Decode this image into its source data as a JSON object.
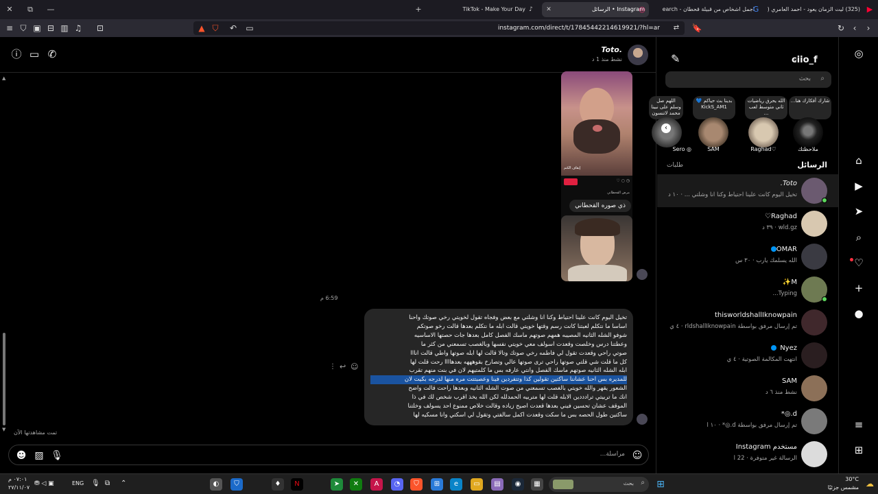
{
  "browser": {
    "tabs": [
      {
        "title": "(325) ليت الزمان يعود - احمد العامري (",
        "active": false
      },
      {
        "title": "اجمل اشخاص من قبيلة قحطان - earch",
        "active": false
      },
      {
        "title": "Instagram • الرسائل",
        "active": true
      },
      {
        "title": "TikTok - Make Your Day",
        "active": false
      }
    ],
    "url": "instagram.com/direct/t/17845442214619921/?hl=ar"
  },
  "chat": {
    "contact_name": "Toto.",
    "contact_status": "نشط منذ 1 د",
    "image_caption": "ذي صوره القحطاني",
    "timestamp": "6:59 م",
    "long_message_lines": [
      "تخيل اليوم كانت علينا احتياط وكنا انا وشلتي مع بعض وفجاه تقول لخويتي رخي صوتك واحنا",
      "اساسا ما نتكلم لعبتنا كانت رسم وقتها خويتي قالت ابله ما نتكلم بعدها قالت رخو صوتكم",
      "شوفو الشله الثانيه المصيبه همهم صوتهم ماسك الفصل كامل بعدها جات حصتها الاساسيه",
      "وعطتنا درس وخلصت وقعدت اسولف معي خويتي نفسها وبالغصب تسمعني من كثر ما",
      "صوتي راحي وقعدت تقول لي فاطمه رخي صوتك وتالا قالت لها ابله صوتها واطي قالت انااا",
      "كل ما قلت شي قلتي صوتها راحي ترى صوتها عالي وتصارخ بقوهههه بعدهاااا رحت قلت لها",
      "ابله الشله الثانيه صوتهم ماسك الفصل وانتي عارفه بس ما كلمتيهم لان في بنت منهم تقرب",
      "للمديره بس احنا عشاننا ساكتين تقولين كذا وتتفردين فينا وعصبتتت مره منها لدرجه بكيت لان",
      "الشعور يقهر والله خويتي بالغصب تسمعني من صوت الشله الثانيه وبعدها راحت قالت واضح",
      "انك ما تربيتي ترادددين الابله قلت لها متربيه الحمدلله لكن الله يخذ اقرب شخص لك في ذا",
      "الموقف عشان تحسين فيني بعدها قعدت اصيح زياده وقالت خلاص ممنوع احد يسولف وخلتنا",
      "ساكتين طول الحصه بس ما سكت وقعدت اكمل سالفتي وتقول لي اسكتي وانا مسكيه لها"
    ],
    "seen_label": "تمت مشاهدتها الآن",
    "composer_placeholder": "مراسلة...",
    "video_overlay": "إيقاف الكتم",
    "video_caption": "مرض القحطاني"
  },
  "inbox": {
    "username": "ciio_f",
    "search_placeholder": "بحث",
    "notes": [
      {
        "note": "شارك أفكارك هنا...",
        "label": "ملاحظتك"
      },
      {
        "note": "الله يحرق رياضيات ثاني متوسط لعب ...",
        "label": "Raghad♡"
      },
      {
        "note": "بدينا بث حياكم 💙 KickS_AM1",
        "label": "SAM"
      },
      {
        "note": "اللهم صل وسلم على نبينا محمد لاتنسون عبد",
        "label": "Sero ◎"
      }
    ],
    "tab_messages": "الرسائل",
    "tab_requests": "طلبات",
    "conversations": [
      {
        "name": "Toto.",
        "preview": "تخيل اليوم كانت علينا احتياط وكنا انا وشلتي ... · ١٠ د",
        "color": "#6b5a70"
      },
      {
        "name": "Raghad♡",
        "preview": "wld.gz · ٣٩ د",
        "color": "#d8c8b0"
      },
      {
        "name": "OMAR",
        "preview": "الله يسلمك يارب · ٣٠ س",
        "color": "#3a3a42"
      },
      {
        "name": "M✨",
        "preview": "Typing...",
        "color": "#6e7a52"
      },
      {
        "name": "thisworldshallIknowpain",
        "preview": "تم إرسال مرفق بواسطة rldshallIknowpain · ٤ ي",
        "color": "#40282c"
      },
      {
        "name": "Nyez",
        "preview": "انتهت المكالمة الصوتية · ٤ ي",
        "color": "#2a1e20"
      },
      {
        "name": "SAM",
        "preview": "نشط منذ ٦ د",
        "color": "#8c7058"
      },
      {
        "name": "d.◎*",
        "preview": "تم إرسال مرفق بواسطة d.◎* · ١٠ أ",
        "color": "#7a7a7a"
      },
      {
        "name": "مستخدم Instagram",
        "preview": "الرسالة غير متوفرة · 22 أ",
        "color": "#dcdcdc"
      }
    ]
  },
  "taskbar": {
    "weather_temp": "30°C",
    "weather_desc": "مشمس جزئيًا",
    "search_placeholder": "بحث",
    "language": "ENG",
    "time": "٠٧:٠١ م",
    "date": "٢٧/١١/٠٧"
  },
  "colors": {
    "accent": "#0095f6",
    "online": "#5cd65c",
    "highlight": "#1a53a0",
    "notification": "#ff3040"
  }
}
